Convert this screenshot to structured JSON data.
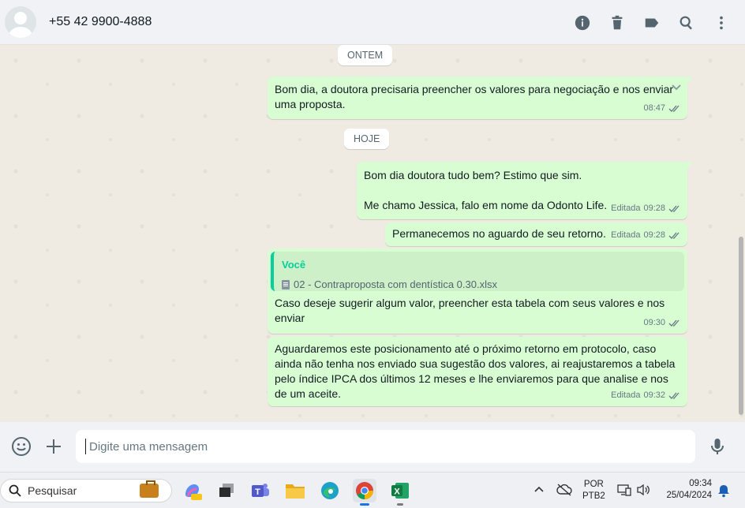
{
  "header": {
    "contact_name": "+55 42 9900-4888",
    "actions": [
      {
        "icon": "info-icon"
      },
      {
        "icon": "trash-icon"
      },
      {
        "icon": "label-icon"
      },
      {
        "icon": "search-icon"
      },
      {
        "icon": "menu-icon"
      }
    ]
  },
  "chat": {
    "day_labels": {
      "yesterday": "ONTEM",
      "today": "HOJE"
    },
    "messages": [
      {
        "text": "Bom dia, a doutora precisaria preencher os valores para negociação e nos enviar uma proposta.",
        "time": "08:47",
        "edited": ""
      },
      {
        "text": "Bom dia doutora tudo bem? Estimo que sim.\n\nMe chamo Jessica, falo em nome da Odonto Life.",
        "time": "09:28",
        "edited": "Editada"
      },
      {
        "text": "Permanecemos no aguardo de seu retorno.",
        "time": "09:28",
        "edited": "Editada"
      },
      {
        "quote_author": "Você",
        "quote_file": "02 - Contraproposta com dentística 0.30.xlsx",
        "text": "Caso deseje sugerir algum valor, preencher esta tabela com seus valores e nos enviar",
        "time": "09:30",
        "edited": ""
      },
      {
        "text": "Aguardaremos este posicionamento até o próximo retorno em protocolo, caso ainda não tenha nos enviado sua sugestão dos valores, ai reajustaremos a tabela pelo índice IPCA dos últimos 12 meses e lhe enviaremos para que analise e nos de um aceite.",
        "time": "09:32",
        "edited": "Editada"
      }
    ]
  },
  "composer": {
    "placeholder": "Digite uma mensagem"
  },
  "taskbar": {
    "search_label": "Pesquisar",
    "apps": [
      "copilot",
      "task-view",
      "teams",
      "file-explorer",
      "edge",
      "chrome",
      "excel"
    ],
    "language_line1": "POR",
    "language_line2": "PTB2",
    "time": "09:34",
    "date": "25/04/2024"
  },
  "colors": {
    "bubble_out": "#d9fdd3",
    "chat_bg": "#efeae2",
    "header_bg": "#f0f2f5",
    "accent_green": "#06cf9c",
    "tick_color": "#667781"
  }
}
